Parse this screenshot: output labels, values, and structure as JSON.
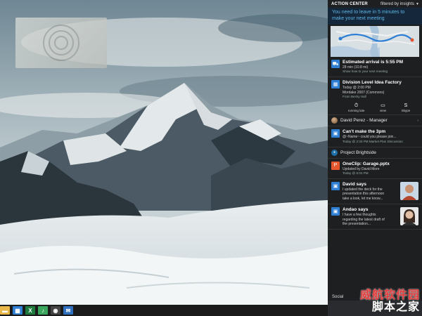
{
  "wallpaper": {
    "scene": "snowy-mountains"
  },
  "taskbar": {
    "icons": [
      {
        "name": "file-explorer-icon",
        "color": "#e8b84a",
        "glyph": "▬"
      },
      {
        "name": "store-icon",
        "color": "#2f7fd4",
        "glyph": "▦"
      },
      {
        "name": "excel-icon",
        "color": "#1f7a3e",
        "glyph": "X"
      },
      {
        "name": "spotify-icon",
        "color": "#3aa55c",
        "glyph": "♪"
      },
      {
        "name": "camera-icon",
        "color": "#444444",
        "glyph": "◉"
      },
      {
        "name": "outlook-icon",
        "color": "#2f6fbf",
        "glyph": "✉"
      }
    ]
  },
  "action_center": {
    "title": "ACTION CENTER",
    "filter_label": "filtered by insights",
    "banner": "You need to leave in 5 minutes to make your next meeting",
    "accent": "#2f7fd4",
    "notifications": {
      "arrival": {
        "title": "Estimated arrival is 5:55 PM",
        "line1": "28 min (10.8 mi)",
        "line2": "Show how to your next meeting"
      },
      "meeting": {
        "title": "Division Level Idea Factory",
        "line1": "Today @ 2:00 PM",
        "line2": "Mordake 2007 (Commons)",
        "line3": "From Becky Hall",
        "actions": [
          {
            "label": "running late",
            "glyph": "⏱",
            "name": "running-late-icon"
          },
          {
            "label": "view",
            "glyph": "▭",
            "name": "view-icon"
          },
          {
            "label": "Skype",
            "glyph": "S",
            "name": "skype-icon"
          }
        ]
      }
    },
    "groups": {
      "david": {
        "name": "David Perez - Manager",
        "message": {
          "title": "Can't make the 3pm",
          "line1": "@~Name~ could you please join...",
          "line2": "Today @ 2:30 PM Market Plan Discussion"
        }
      },
      "project": {
        "name": "Project Brightside",
        "items": [
          {
            "title": "OneClip: Garage.pptx",
            "line1": "Updated by David More",
            "line2": "Today @ 6:04 PM",
            "color": "#e4572e",
            "glyph": "P"
          },
          {
            "title": "David says",
            "line1": "I updated the deck for the",
            "line2": "presentation this afternoon",
            "line3": "take a look, let me know...",
            "color": "#2f7fd4",
            "glyph": "▣"
          },
          {
            "title": "Andao says",
            "line1": "I have a few thoughts",
            "line2": "regarding the latest draft of",
            "line3": "the presentation...",
            "color": "#2f7fd4",
            "glyph": "▣"
          }
        ]
      }
    },
    "social_label": "Social"
  },
  "watermark": {
    "line1": "威航软件园",
    "line2": "脚本之家"
  }
}
